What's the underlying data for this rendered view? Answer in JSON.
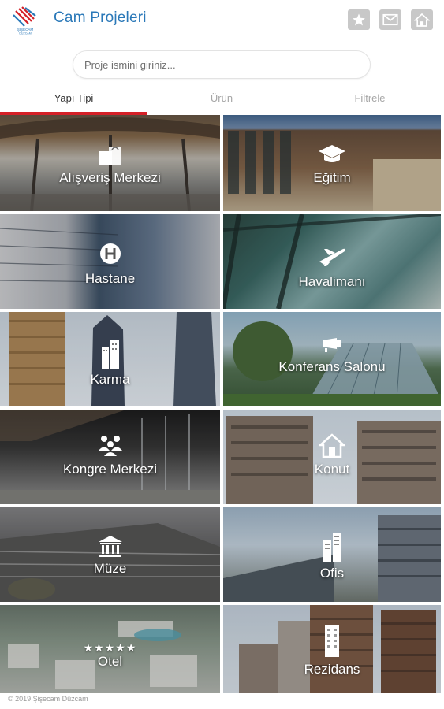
{
  "header": {
    "logo_text": "ŞIŞECAM DÜZCAM",
    "title": "Cam Projeleri",
    "buttons": [
      {
        "name": "favorites",
        "icon": "star-icon"
      },
      {
        "name": "mail",
        "icon": "envelope-icon"
      },
      {
        "name": "home",
        "icon": "home-icon"
      }
    ]
  },
  "search": {
    "placeholder": "Proje ismini giriniz...",
    "value": ""
  },
  "tabs": [
    {
      "label": "Yapı Tipi",
      "active": true
    },
    {
      "label": "Ürün",
      "active": false
    },
    {
      "label": "Filtrele",
      "active": false
    }
  ],
  "categories": [
    {
      "label": "Alışveriş Merkezi",
      "icon": "shopping-bags-icon"
    },
    {
      "label": "Eğitim",
      "icon": "graduation-cap-icon"
    },
    {
      "label": "Hastane",
      "icon": "hospital-h-icon"
    },
    {
      "label": "Havalimanı",
      "icon": "airplane-icon"
    },
    {
      "label": "Karma",
      "icon": "buildings-icon"
    },
    {
      "label": "Konferans Salonu",
      "icon": "projector-icon"
    },
    {
      "label": "Kongre Merkezi",
      "icon": "people-group-icon"
    },
    {
      "label": "Konut",
      "icon": "house-icon"
    },
    {
      "label": "Müze",
      "icon": "museum-icon"
    },
    {
      "label": "Ofis",
      "icon": "office-tower-icon"
    },
    {
      "label": "Otel",
      "icon": "stars-icon",
      "stars": "★★★★★"
    },
    {
      "label": "Rezidans",
      "icon": "residence-tower-icon"
    }
  ],
  "footer": {
    "copyright": "© 2019 Şişecam Düzcam"
  },
  "colors": {
    "brand_blue": "#2a78b8",
    "active_tab_red": "#d42027",
    "icon_button_gray": "#c8c8c8"
  }
}
